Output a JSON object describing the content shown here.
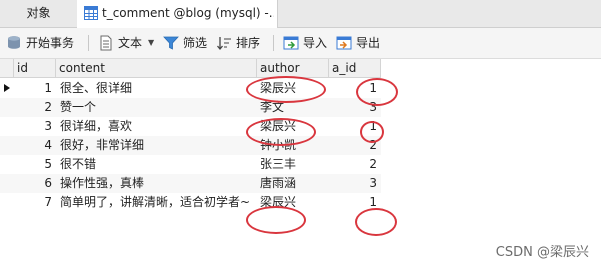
{
  "tabs": {
    "objects_label": "对象",
    "active_label": "t_comment @blog (mysql) -..."
  },
  "toolbar": {
    "begin_transaction": "开始事务",
    "text": "文本",
    "filter": "筛选",
    "sort": "排序",
    "import": "导入",
    "export": "导出"
  },
  "grid": {
    "columns": [
      "id",
      "content",
      "author",
      "a_id"
    ],
    "rows": [
      {
        "id": "1",
        "content": "很全、很详细",
        "author": "梁辰兴",
        "a_id": "1"
      },
      {
        "id": "2",
        "content": "赞一个",
        "author": "李文",
        "a_id": "3"
      },
      {
        "id": "3",
        "content": "很详细，喜欢",
        "author": "梁辰兴",
        "a_id": "1"
      },
      {
        "id": "4",
        "content": "很好，非常详细",
        "author": "钟小凯",
        "a_id": "2"
      },
      {
        "id": "5",
        "content": "很不错",
        "author": "张三丰",
        "a_id": "2"
      },
      {
        "id": "6",
        "content": "操作性强，真棒",
        "author": "唐雨涵",
        "a_id": "3"
      },
      {
        "id": "7",
        "content": "简单明了，讲解清晰，适合初学者~",
        "author": "梁辰兴",
        "a_id": "1"
      }
    ]
  },
  "watermark": "CSDN @梁辰兴",
  "colors": {
    "annotation": "#d9363e",
    "toolbar_bg": "#f5f5f5",
    "tab_bg": "#e9e9e9"
  }
}
